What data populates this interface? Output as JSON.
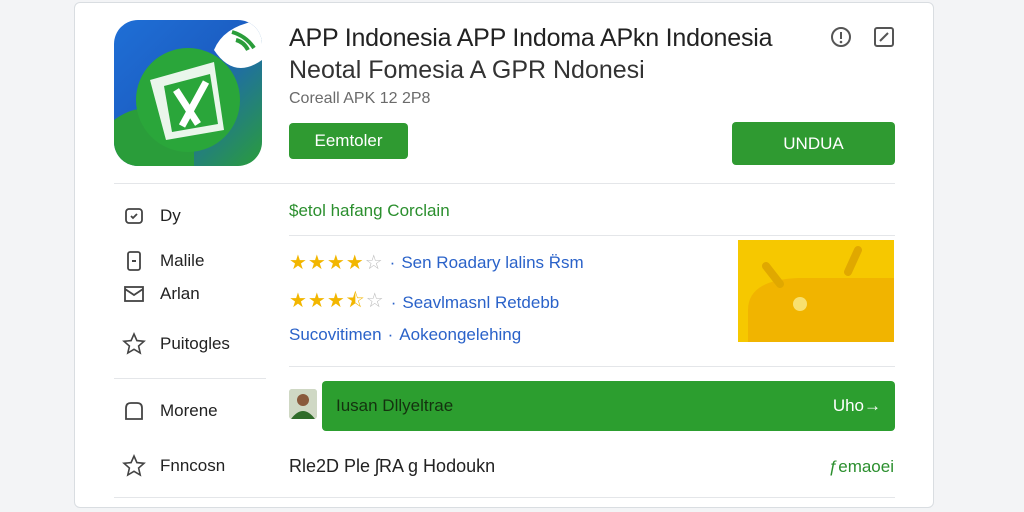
{
  "header": {
    "title": "APP Indonesia APP Indoma APkn Indonesia",
    "subtitle": "Neotal Fomesia A GPR Ndonesi",
    "meta": "Coreall APK 12 2P8",
    "primary_button": "Eemtoler",
    "install_button": "UNDUA"
  },
  "sidebar": {
    "items": [
      {
        "label": "Dy",
        "icon": "shield-icon"
      },
      {
        "label": "Malile",
        "icon": "phone-icon"
      },
      {
        "label": "Arlan",
        "icon": "mail-icon"
      },
      {
        "label": "Puitogles",
        "icon": "star-icon"
      },
      {
        "label": "Morene",
        "icon": "folder-icon"
      },
      {
        "label": "Fnncosn",
        "icon": "star-icon"
      }
    ]
  },
  "content": {
    "headline_link": "$etol hafang Corclain",
    "ratings": [
      {
        "stars": 4,
        "text": "Sen Roadary lalins R̈sm"
      },
      {
        "stars": 3.5,
        "text": "Seavlmasnl Retdebb"
      }
    ],
    "subline_a": "Sucovitimen",
    "subline_b": "Aokeongelehing",
    "banner": {
      "label": "Iusan Dllyeltrae",
      "action": "Uho→"
    },
    "footer_left": "Rle2D Ple ʃRA g Hodoukn",
    "footer_right": "ƒemaoei"
  },
  "colors": {
    "accent_green": "#2f9a31",
    "link_blue": "#2a62c9",
    "star_yellow": "#f2b600",
    "thumb_yellow": "#f6c800"
  }
}
